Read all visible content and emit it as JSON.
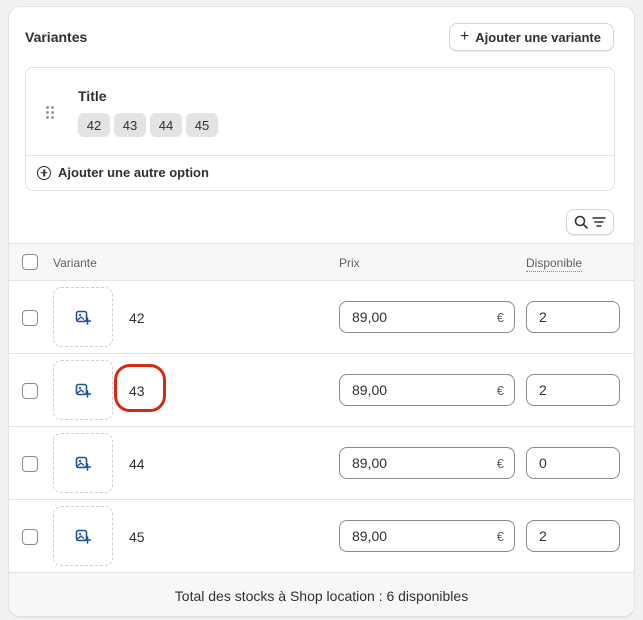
{
  "header": {
    "title": "Variantes",
    "add_variant_label": "Ajouter une variante"
  },
  "options": {
    "name": "Title",
    "values": [
      "42",
      "43",
      "44",
      "45"
    ],
    "add_option_label": "Ajouter une autre option"
  },
  "table": {
    "columns": {
      "variant": "Variante",
      "price": "Prix",
      "available": "Disponible"
    },
    "rows": [
      {
        "name": "42",
        "price": "89,00",
        "currency": "€",
        "available": "2"
      },
      {
        "name": "43",
        "price": "89,00",
        "currency": "€",
        "available": "2"
      },
      {
        "name": "44",
        "price": "89,00",
        "currency": "€",
        "available": "0"
      },
      {
        "name": "45",
        "price": "89,00",
        "currency": "€",
        "available": "2"
      }
    ]
  },
  "footer": {
    "total_text": "Total des stocks à Shop location : 6 disponibles"
  },
  "annotation": {
    "highlighted_row": 1,
    "color": "#d42a12"
  },
  "icons": {
    "add_image": "image-add-icon",
    "search": "search-icon",
    "filter": "filter-icon",
    "drag": "drag-handle-icon"
  },
  "colors": {
    "accent": "#1f5199",
    "border": "#e3e3e3"
  }
}
